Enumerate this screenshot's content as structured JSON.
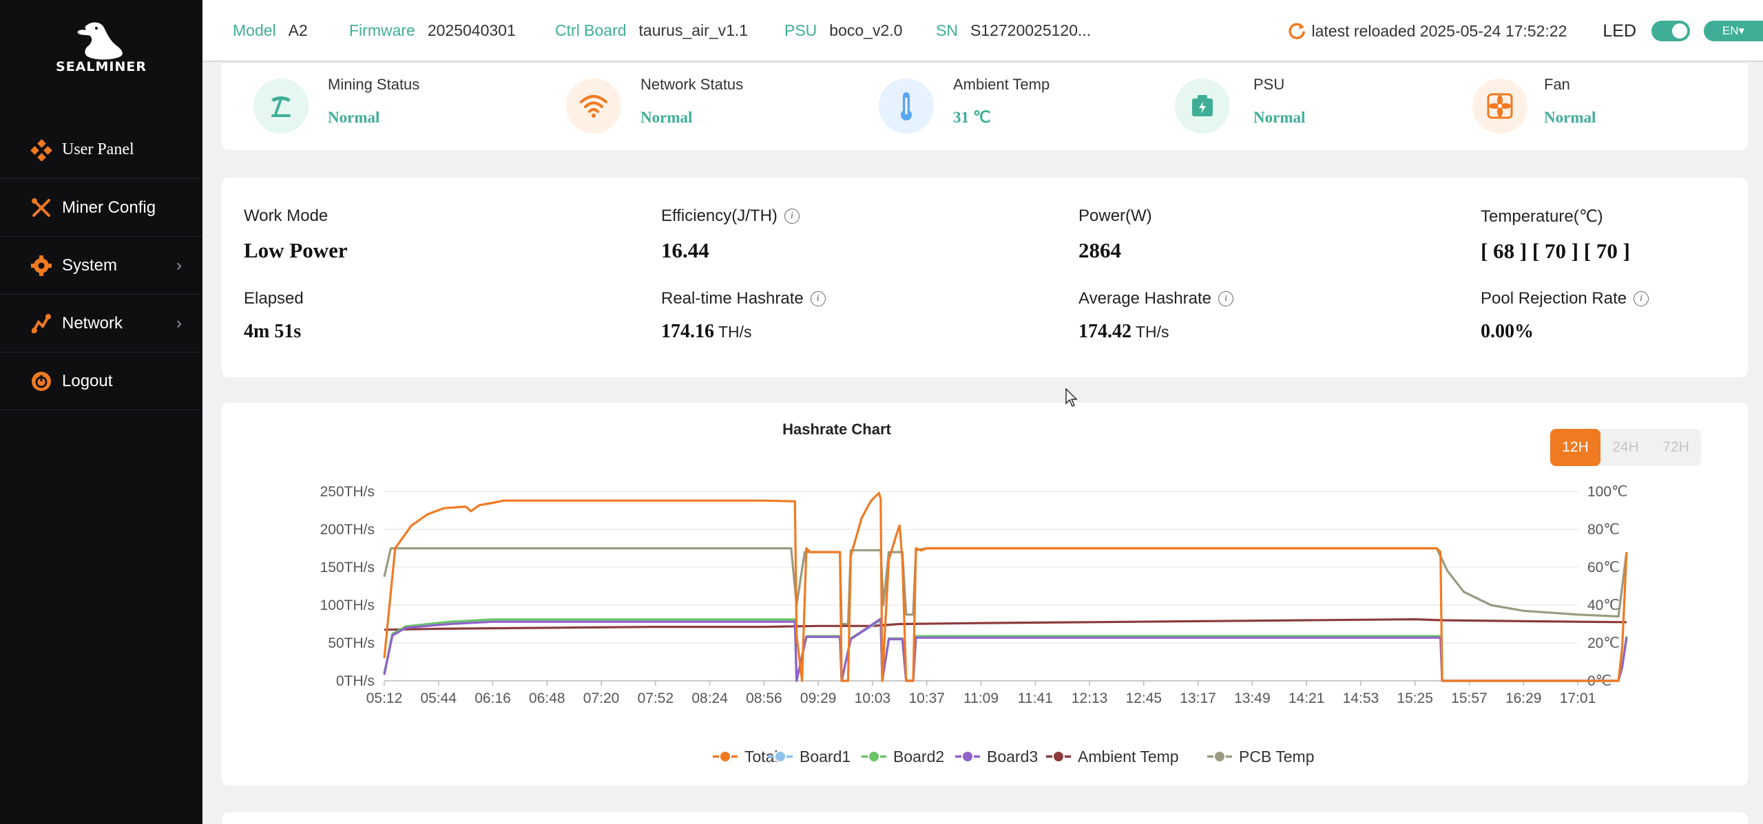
{
  "sidebar": {
    "logo_text": "SEALMINER",
    "items": [
      {
        "label": "User Panel",
        "icon": "user-panel-icon",
        "has_arrow": false
      },
      {
        "label": "Miner Config",
        "icon": "wrench-icon",
        "has_arrow": false
      },
      {
        "label": "System",
        "icon": "gear-icon",
        "has_arrow": true
      },
      {
        "label": "Network",
        "icon": "network-icon",
        "has_arrow": true
      },
      {
        "label": "Logout",
        "icon": "power-icon",
        "has_arrow": false
      }
    ],
    "arrow_glyph": "›"
  },
  "header": {
    "model_label": "Model",
    "model_value": "A2",
    "firmware_label": "Firmware",
    "firmware_value": "2025040301",
    "ctrl_label": "Ctrl Board",
    "ctrl_value": "taurus_air_v1.1",
    "psu_label": "PSU",
    "psu_value": "boco_v2.0",
    "sn_label": "SN",
    "sn_value": "S12720025120...",
    "reload_text": "latest reloaded 2025-05-24 17:52:22",
    "led_label": "LED",
    "lang": "EN▾",
    "accent_color": "#3fae97"
  },
  "status": [
    {
      "title": "Mining Status",
      "value": "Normal",
      "icon": "pickaxe-icon",
      "bg": "#e6f6f1"
    },
    {
      "title": "Network Status",
      "value": "Normal",
      "icon": "wifi-icon",
      "bg": "#fff1e6"
    },
    {
      "title": "Ambient Temp",
      "value": "31 ℃",
      "icon": "thermometer-icon",
      "bg": "#e6f2ff"
    },
    {
      "title": "PSU",
      "value": "Normal",
      "icon": "battery-icon",
      "bg": "#e6f6f1"
    },
    {
      "title": "Fan",
      "value": "Normal",
      "icon": "fan-icon",
      "bg": "#fff1e6"
    }
  ],
  "metrics": {
    "work_mode_label": "Work Mode",
    "work_mode_value": "Low Power",
    "efficiency_label": "Efficiency(J/TH)",
    "efficiency_value": "16.44",
    "power_label": "Power(W)",
    "power_value": "2864",
    "temperature_label": "Temperature(℃)",
    "temperature_value": "[ 68 ] [ 70 ] [ 70 ]",
    "elapsed_label": "Elapsed",
    "elapsed_value": "4m 51s",
    "realtime_label": "Real-time Hashrate",
    "realtime_value": "174.16",
    "realtime_unit": "TH/s",
    "average_label": "Average Hashrate",
    "average_value": "174.42",
    "average_unit": "TH/s",
    "rejection_label": "Pool Rejection Rate",
    "rejection_value": "0.00%",
    "info_glyph": "i"
  },
  "chart_ui": {
    "range_buttons": [
      "12H",
      "24H",
      "72H"
    ],
    "active_range": "12H"
  },
  "chart_data": {
    "type": "line",
    "title": "Hashrate Chart",
    "x": [
      "05:12",
      "05:44",
      "06:16",
      "06:48",
      "07:20",
      "07:52",
      "08:24",
      "08:56",
      "09:29",
      "10:03",
      "10:37",
      "11:09",
      "11:41",
      "12:13",
      "12:45",
      "13:17",
      "13:49",
      "14:21",
      "14:53",
      "15:25",
      "15:57",
      "16:29",
      "17:01"
    ],
    "y_left": {
      "ticks": [
        "0TH/s",
        "50TH/s",
        "100TH/s",
        "150TH/s",
        "200TH/s",
        "250TH/s"
      ],
      "range": [
        0,
        250
      ]
    },
    "y_right": {
      "ticks": [
        "0℃",
        "20℃",
        "40℃",
        "60℃",
        "80℃",
        "100℃"
      ],
      "range": [
        0,
        100
      ]
    },
    "series": [
      {
        "name": "Total",
        "axis": "left",
        "color": "#f07a22",
        "points": [
          [
            0,
            30
          ],
          [
            0.2,
            175
          ],
          [
            0.5,
            205
          ],
          [
            0.8,
            220
          ],
          [
            1.1,
            228
          ],
          [
            1.5,
            230
          ],
          [
            1.6,
            224
          ],
          [
            1.75,
            232
          ],
          [
            2.0,
            235
          ],
          [
            2.2,
            238
          ],
          [
            3,
            238
          ],
          [
            5,
            238
          ],
          [
            7,
            238
          ],
          [
            7.57,
            237
          ],
          [
            7.6,
            60
          ],
          [
            7.7,
            0
          ],
          [
            7.78,
            175
          ],
          [
            7.85,
            170
          ],
          [
            8.4,
            170
          ],
          [
            8.43,
            0
          ],
          [
            8.55,
            0
          ],
          [
            8.6,
            165
          ],
          [
            8.8,
            215
          ],
          [
            8.95,
            235
          ],
          [
            9.0,
            240
          ],
          [
            9.12,
            248
          ],
          [
            9.15,
            240
          ],
          [
            9.18,
            0
          ],
          [
            9.3,
            160
          ],
          [
            9.45,
            195
          ],
          [
            9.5,
            205
          ],
          [
            9.55,
            160
          ],
          [
            9.62,
            0
          ],
          [
            9.75,
            0
          ],
          [
            9.8,
            175
          ],
          [
            9.9,
            172
          ],
          [
            10.0,
            175
          ],
          [
            12,
            175
          ],
          [
            15,
            175
          ],
          [
            19.4,
            175
          ],
          [
            19.47,
            170
          ],
          [
            19.5,
            0
          ],
          [
            20.5,
            0
          ],
          [
            22.5,
            0
          ],
          [
            22.75,
            0
          ],
          [
            22.82,
            45
          ],
          [
            22.9,
            170
          ]
        ]
      },
      {
        "name": "Board1",
        "axis": "left",
        "color": "#8fc4ee",
        "points": [
          [
            0,
            10
          ],
          [
            0.15,
            60
          ],
          [
            0.4,
            70
          ],
          [
            1.2,
            76
          ],
          [
            2.0,
            79
          ],
          [
            3,
            79
          ],
          [
            7.57,
            79
          ],
          [
            7.6,
            0
          ],
          [
            7.78,
            58
          ],
          [
            8.4,
            58
          ],
          [
            8.43,
            0
          ],
          [
            8.6,
            55
          ],
          [
            9.15,
            80
          ],
          [
            9.18,
            0
          ],
          [
            9.3,
            55
          ],
          [
            9.55,
            55
          ],
          [
            9.62,
            0
          ],
          [
            9.75,
            0
          ],
          [
            9.8,
            58
          ],
          [
            10,
            58
          ],
          [
            19.47,
            58
          ],
          [
            19.5,
            0
          ],
          [
            22.75,
            0
          ],
          [
            22.82,
            20
          ],
          [
            22.9,
            58
          ]
        ]
      },
      {
        "name": "Board2",
        "axis": "left",
        "color": "#6bc46a",
        "points": [
          [
            0,
            10
          ],
          [
            0.15,
            62
          ],
          [
            0.4,
            72
          ],
          [
            1.2,
            78
          ],
          [
            2.0,
            81
          ],
          [
            3,
            81
          ],
          [
            7.57,
            81
          ],
          [
            7.6,
            0
          ],
          [
            7.78,
            59
          ],
          [
            8.4,
            59
          ],
          [
            8.43,
            0
          ],
          [
            8.6,
            56
          ],
          [
            9.15,
            81
          ],
          [
            9.18,
            0
          ],
          [
            9.3,
            56
          ],
          [
            9.55,
            56
          ],
          [
            9.62,
            0
          ],
          [
            9.75,
            0
          ],
          [
            9.8,
            59
          ],
          [
            10,
            59
          ],
          [
            19.47,
            59
          ],
          [
            19.5,
            0
          ],
          [
            22.75,
            0
          ],
          [
            22.82,
            20
          ],
          [
            22.9,
            59
          ]
        ]
      },
      {
        "name": "Board3",
        "axis": "left",
        "color": "#8f62c9",
        "points": [
          [
            0,
            8
          ],
          [
            0.15,
            60
          ],
          [
            0.4,
            70
          ],
          [
            1.2,
            75
          ],
          [
            2.0,
            78
          ],
          [
            3,
            78
          ],
          [
            7.57,
            78
          ],
          [
            7.6,
            0
          ],
          [
            7.78,
            58
          ],
          [
            8.4,
            58
          ],
          [
            8.43,
            0
          ],
          [
            8.6,
            55
          ],
          [
            9.15,
            82
          ],
          [
            9.18,
            0
          ],
          [
            9.3,
            55
          ],
          [
            9.55,
            55
          ],
          [
            9.62,
            0
          ],
          [
            9.75,
            0
          ],
          [
            9.8,
            57
          ],
          [
            10,
            57
          ],
          [
            19.47,
            57
          ],
          [
            19.5,
            0
          ],
          [
            22.75,
            0
          ],
          [
            22.82,
            18
          ],
          [
            22.9,
            57
          ]
        ]
      },
      {
        "name": "Ambient Temp",
        "axis": "right",
        "color": "#8b3b3b",
        "points": [
          [
            0,
            27
          ],
          [
            1,
            27.5
          ],
          [
            3,
            28
          ],
          [
            5,
            28.5
          ],
          [
            7,
            28.5
          ],
          [
            8,
            29
          ],
          [
            9,
            29
          ],
          [
            9.5,
            30
          ],
          [
            11,
            30.5
          ],
          [
            13,
            31
          ],
          [
            15,
            31.5
          ],
          [
            17,
            32
          ],
          [
            19,
            32.5
          ],
          [
            19.5,
            32
          ],
          [
            21,
            31.5
          ],
          [
            22.9,
            31
          ]
        ]
      },
      {
        "name": "PCB Temp",
        "axis": "right",
        "color": "#9a9a80",
        "points": [
          [
            0,
            55
          ],
          [
            0.12,
            70
          ],
          [
            0.3,
            70
          ],
          [
            2,
            70
          ],
          [
            5,
            70
          ],
          [
            7.5,
            70
          ],
          [
            7.6,
            40
          ],
          [
            7.75,
            68
          ],
          [
            8.4,
            68
          ],
          [
            8.43,
            30
          ],
          [
            8.55,
            30
          ],
          [
            8.6,
            69
          ],
          [
            9.15,
            69
          ],
          [
            9.2,
            40
          ],
          [
            9.3,
            68
          ],
          [
            9.55,
            68
          ],
          [
            9.62,
            35
          ],
          [
            9.75,
            35
          ],
          [
            9.8,
            69
          ],
          [
            10,
            70
          ],
          [
            19.4,
            70
          ],
          [
            19.6,
            58
          ],
          [
            19.9,
            47
          ],
          [
            20.4,
            40
          ],
          [
            21,
            37
          ],
          [
            22,
            35
          ],
          [
            22.75,
            34
          ],
          [
            22.9,
            68
          ]
        ]
      }
    ],
    "legend_position": "bottom",
    "grid": true
  }
}
